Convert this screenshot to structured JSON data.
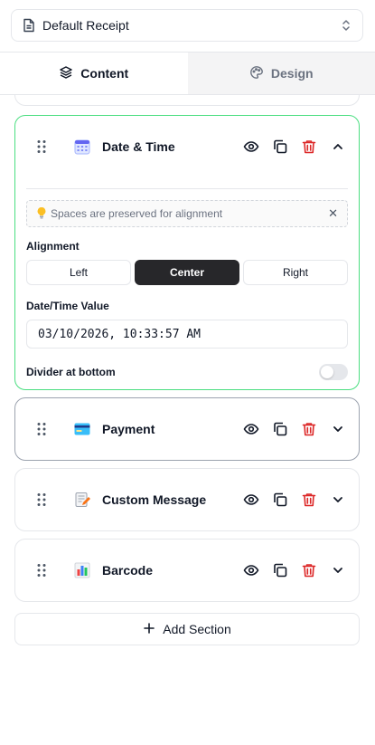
{
  "template_select": {
    "value": "Default Receipt",
    "icon": "document-icon"
  },
  "tabs": [
    {
      "label": "Content",
      "icon": "layers-icon",
      "active": true
    },
    {
      "label": "Design",
      "icon": "palette-icon",
      "active": false
    }
  ],
  "sections": [
    {
      "title": "Date & Time",
      "icon": "calendar-emoji-icon",
      "expanded": true,
      "hint": "Spaces are preserved for alignment",
      "alignment_label": "Alignment",
      "alignment_options": [
        "Left",
        "Center",
        "Right"
      ],
      "alignment_selected": "Center",
      "value_label": "Date/Time Value",
      "value": "03/10/2026, 10:33:57 AM",
      "divider_label": "Divider at bottom",
      "divider_on": false
    },
    {
      "title": "Payment",
      "icon": "credit-card-emoji-icon",
      "expanded": false
    },
    {
      "title": "Custom Message",
      "icon": "memo-emoji-icon",
      "expanded": false
    },
    {
      "title": "Barcode",
      "icon": "bar-chart-emoji-icon",
      "expanded": false
    }
  ],
  "add_section_label": "Add Section",
  "colors": {
    "expanded_border": "#4ade80",
    "delete_red": "#dc2626",
    "selected_dark": "#27272a"
  }
}
